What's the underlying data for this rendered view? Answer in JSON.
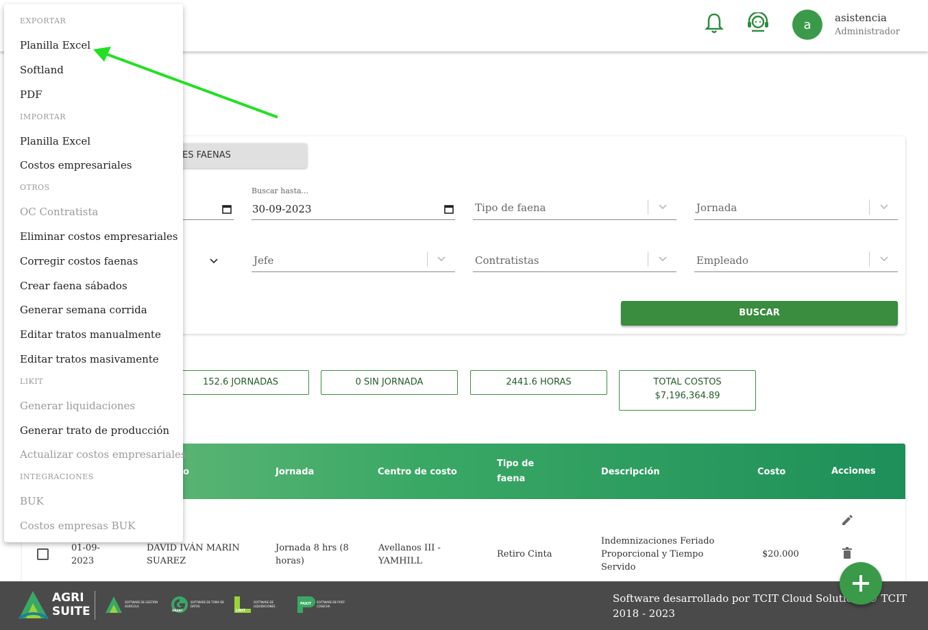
{
  "header": {
    "notifications_icon": "bell-icon",
    "support_icon": "headset-icon",
    "avatar_initial": "a",
    "user_name": "asistencia",
    "user_role": "Administrador"
  },
  "menu": {
    "sections": [
      {
        "header": "EXPORTAR",
        "items": [
          {
            "label": "Planilla Excel",
            "disabled": false
          },
          {
            "label": "Softland",
            "disabled": false
          },
          {
            "label": "PDF",
            "disabled": false
          }
        ]
      },
      {
        "header": "IMPORTAR",
        "items": [
          {
            "label": "Planilla Excel",
            "disabled": false
          },
          {
            "label": "Costos empresariales",
            "disabled": false
          }
        ]
      },
      {
        "header": "OTROS",
        "items": [
          {
            "label": "OC Contratista",
            "disabled": true
          },
          {
            "label": "Eliminar costos empresariales",
            "disabled": false
          },
          {
            "label": "Corregir costos faenas",
            "disabled": false
          },
          {
            "label": "Crear faena sábados",
            "disabled": false
          },
          {
            "label": "Generar semana corrida",
            "disabled": false
          },
          {
            "label": "Editar tratos manualmente",
            "disabled": false
          },
          {
            "label": "Editar tratos masivamente",
            "disabled": false
          }
        ]
      },
      {
        "header": "LIKIT",
        "items": [
          {
            "label": "Generar liquidaciones",
            "disabled": true
          },
          {
            "label": "Generar trato de producción",
            "disabled": false
          },
          {
            "label": "Actualizar costos empresariales",
            "disabled": true
          }
        ]
      },
      {
        "header": "INTEGRACIONES",
        "items": [
          {
            "label": "BUK",
            "disabled": true
          },
          {
            "label": "Costos empresas BUK",
            "disabled": true
          }
        ]
      }
    ]
  },
  "filters": {
    "tab_label": "ES FAENAS",
    "hasta_label": "Buscar hasta...",
    "hasta_value": "30-09-2023",
    "tipo_faena": "Tipo de faena",
    "jornada": "Jornada",
    "jefe": "Jefe",
    "contratistas": "Contratistas",
    "empleado": "Empleado",
    "buscar": "BUSCAR"
  },
  "stats": {
    "jornadas": "152.6 JORNADAS",
    "sin_jornada": "0 SIN JORNADA",
    "horas": "2441.6 HORAS",
    "total_label": "TOTAL COSTOS",
    "total_value": "$7,196,364.89"
  },
  "table": {
    "headers": {
      "empleado": "o",
      "jornada": "Jornada",
      "centro": "Centro de costo",
      "tipo_1": "Tipo de",
      "tipo_2": "faena",
      "descripcion": "Descripción",
      "costo": "Costo",
      "acciones": "Acciones"
    },
    "row": {
      "fecha_1": "01-09-",
      "fecha_2": "2023",
      "empleado_1": "DAVID IVÁN MARIN",
      "empleado_2": "SUAREZ",
      "jornada_1": "Jornada 8 hrs (8",
      "jornada_2": "horas)",
      "centro_1": "Avellanos III -",
      "centro_2": "YAMHILL",
      "tipo": "Retiro Cinta",
      "desc_1": "Indemnizaciones Feriado",
      "desc_2": "Proporcional y Tiempo",
      "desc_3": "Servido",
      "costo": "$20.000"
    }
  },
  "footer": {
    "text": "Software desarrollado por TCIT Cloud Solutions © TCIT 2018 - 2023",
    "brand_1": "AGRI",
    "brand_2": "SUITE",
    "logo_small_1": "SOFTWARE DE GESTIÓN AGRÍCOLA",
    "logo_small_2": "SOFTWARE DE TOMA DE DATOS",
    "logo_small_3": "SOFTWARE DE LIQUIDACIONES",
    "logo_small_4": "SOFTWARE DE POST-COSECHA",
    "likit": "LIKIT",
    "pakit": "PAKIT",
    "grant": "GRANT"
  },
  "colors": {
    "primary_green": "#3a8c3f",
    "annotation_arrow": "#22e022"
  }
}
